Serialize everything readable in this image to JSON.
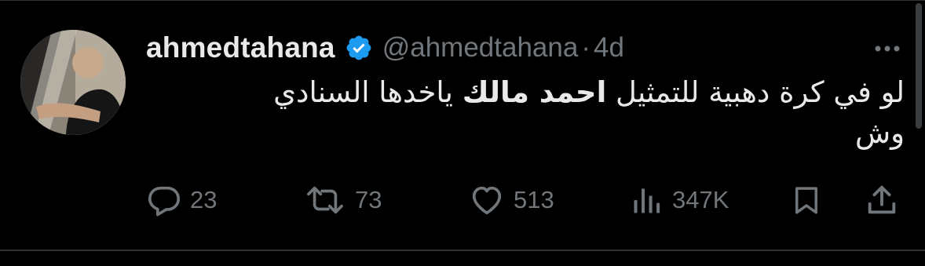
{
  "tweet": {
    "author": {
      "display_name": "ahmedtahana",
      "handle": "@ahmedtahana",
      "verified": true,
      "avatar_icon": "profile-photo"
    },
    "separator": "·",
    "timestamp": "4d",
    "text_line_1_part_1": "لو في كرة دهبية للتمثيل",
    "text_line_1_strong": "احمد مالك",
    "text_line_1_part_2": "ياخدها السنادي",
    "text_line_2": "وش",
    "actions": {
      "reply_count": "23",
      "retweet_count": "73",
      "like_count": "513",
      "views_count": "347K"
    }
  },
  "colors": {
    "background": "#000000",
    "text_primary": "#e7e9ea",
    "text_secondary": "#71767b",
    "verified_blue": "#1d9bf0",
    "divider": "#2f3336"
  }
}
